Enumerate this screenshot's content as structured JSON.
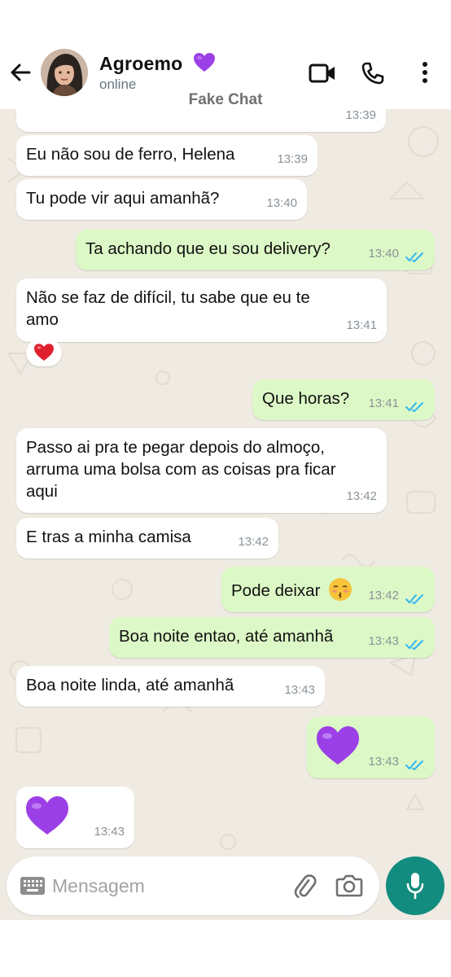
{
  "header": {
    "contact_name": "Agroemo",
    "status": "online",
    "subtitle": "Fake Chat",
    "icons": [
      "back-arrow-icon",
      "video-call-icon",
      "phone-icon",
      "more-vertical-icon"
    ]
  },
  "messages": [
    {
      "dir": "in",
      "text": "",
      "time": "13:39"
    },
    {
      "dir": "in",
      "text": "Eu não sou de ferro, Helena",
      "time": "13:39"
    },
    {
      "dir": "in",
      "text": "Tu pode vir aqui amanhã?",
      "time": "13:40"
    },
    {
      "dir": "out",
      "text": "Ta achando que eu sou delivery?",
      "time": "13:40",
      "read": true
    },
    {
      "dir": "in",
      "text_line1": "Não se faz de difícil, tu sabe que eu te",
      "text_line2": "amo",
      "time": "13:41",
      "reaction": "red-heart"
    },
    {
      "dir": "out",
      "text": "Que horas?",
      "time": "13:41",
      "read": true
    },
    {
      "dir": "in",
      "text_line1": "Passo ai pra te pegar depois do almoço,",
      "text_line2": "arruma uma bolsa com as coisas pra ficar",
      "text_line3": "aqui",
      "time": "13:42"
    },
    {
      "dir": "in",
      "text": "E tras a minha camisa",
      "time": "13:42"
    },
    {
      "dir": "out",
      "text": "Pode deixar",
      "emoji": "kissing-face-with-closed-eyes",
      "time": "13:42",
      "read": true
    },
    {
      "dir": "out",
      "text": "Boa noite entao, até amanhã",
      "time": "13:43",
      "read": true
    },
    {
      "dir": "in",
      "text": "Boa noite linda, até amanhã",
      "time": "13:43"
    },
    {
      "dir": "out",
      "emoji": "purple-heart",
      "time": "13:43",
      "read": true
    },
    {
      "dir": "in",
      "emoji": "purple-heart",
      "time": "13:43"
    }
  ],
  "input": {
    "placeholder": "Mensagem",
    "icons": [
      "keyboard-icon",
      "attach-icon",
      "camera-icon",
      "mic-icon"
    ]
  },
  "colors": {
    "chat_bg": "#efeae2",
    "incoming_bubble": "#ffffff",
    "outgoing_bubble": "#dcf8c6",
    "read_ticks": "#34b7f1",
    "accent": "#128c7e",
    "purple_heart": "#9b40e6"
  }
}
